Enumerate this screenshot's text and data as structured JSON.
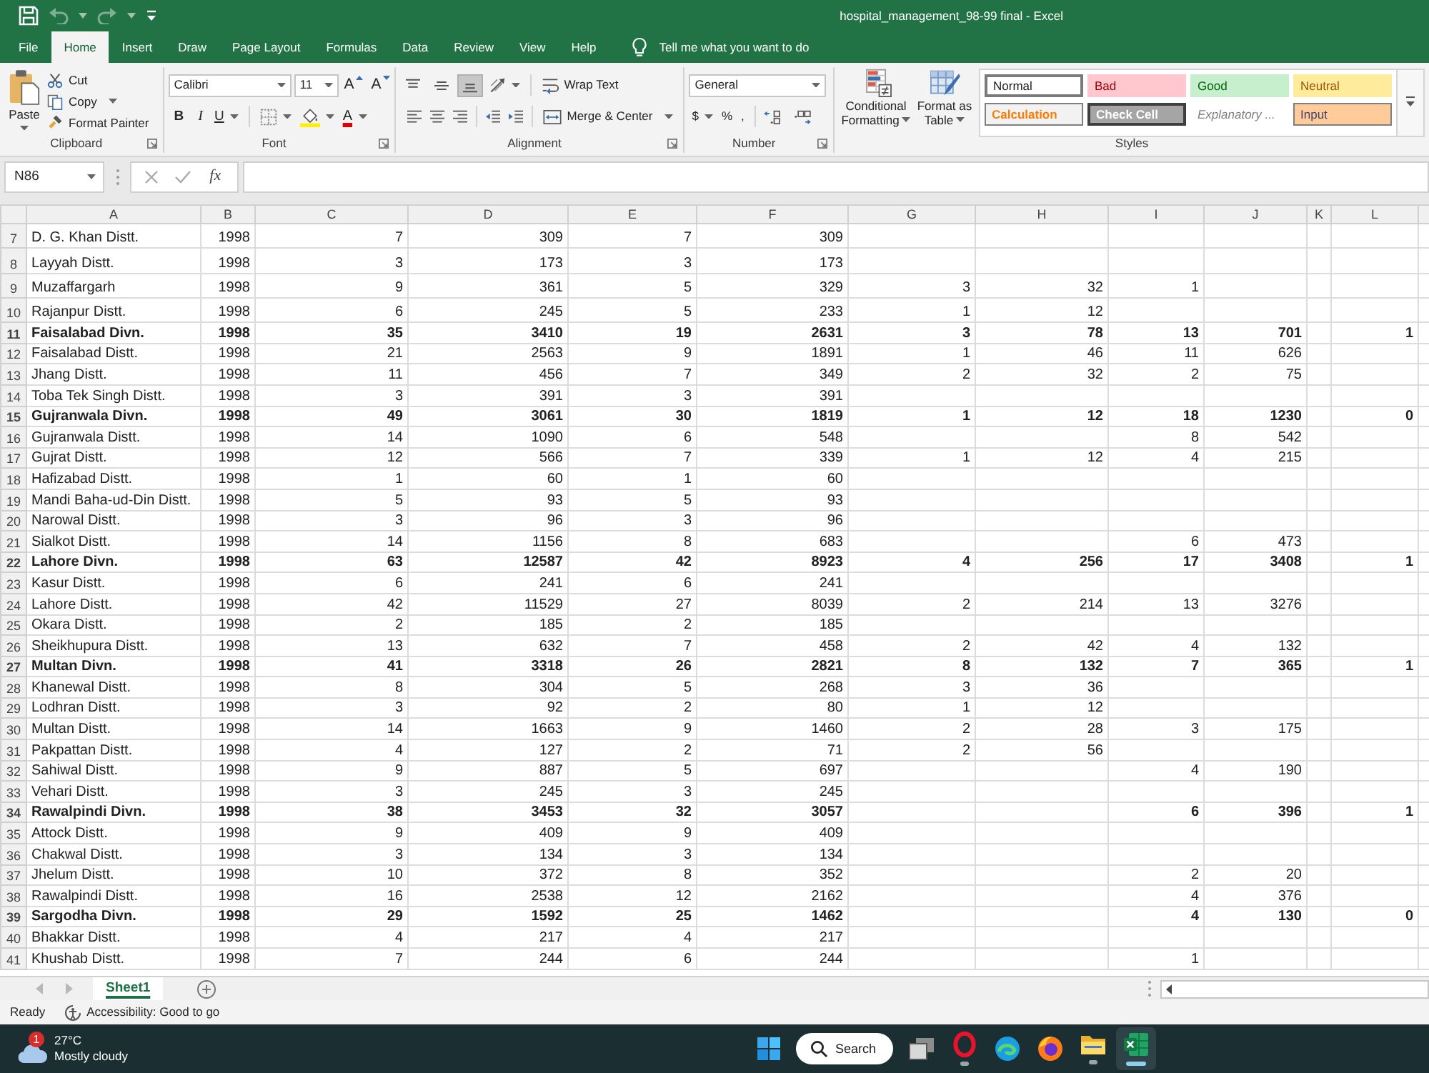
{
  "window": {
    "title": "hospital_management_98-99 final - Excel"
  },
  "menu_tabs": [
    {
      "label": "File",
      "selected": false
    },
    {
      "label": "Home",
      "selected": true
    },
    {
      "label": "Insert",
      "selected": false
    },
    {
      "label": "Draw",
      "selected": false
    },
    {
      "label": "Page Layout",
      "selected": false
    },
    {
      "label": "Formulas",
      "selected": false
    },
    {
      "label": "Data",
      "selected": false
    },
    {
      "label": "Review",
      "selected": false
    },
    {
      "label": "View",
      "selected": false
    },
    {
      "label": "Help",
      "selected": false
    }
  ],
  "tell_me": {
    "placeholder": "Tell me what you want to do"
  },
  "ribbon": {
    "clipboard": {
      "label": "Clipboard",
      "paste": "Paste",
      "cut": "Cut",
      "copy": "Copy",
      "format_painter": "Format Painter"
    },
    "font": {
      "label": "Font",
      "font_name": "Calibri",
      "font_size": "11",
      "grow": "A",
      "shrink": "A",
      "bold": "B",
      "italic": "I",
      "underline": "U",
      "font_color": "A"
    },
    "alignment": {
      "label": "Alignment",
      "vertical_align": [
        {
          "kind": "top",
          "selected": false
        },
        {
          "kind": "middle",
          "selected": false
        },
        {
          "kind": "bottom",
          "selected": true
        }
      ],
      "wrap_text": "Wrap Text",
      "merge_center": "Merge & Center"
    },
    "number": {
      "label": "Number",
      "format": "General",
      "currency": "$",
      "percent": "%",
      "comma": ","
    },
    "styles": {
      "label": "Styles",
      "conditional_formatting": "Conditional Formatting",
      "format_as_table": "Format as Table",
      "gallery": [
        {
          "label": "Normal",
          "kind": "normal",
          "selected": true
        },
        {
          "label": "Bad",
          "kind": "bad",
          "selected": false
        },
        {
          "label": "Good",
          "kind": "good",
          "selected": false
        },
        {
          "label": "Neutral",
          "kind": "neutral",
          "selected": false
        },
        {
          "label": "Calculation",
          "kind": "calculation",
          "selected": false
        },
        {
          "label": "Check Cell",
          "kind": "check",
          "selected": false
        },
        {
          "label": "Explanatory ...",
          "kind": "explanatory",
          "selected": false
        },
        {
          "label": "Input",
          "kind": "input",
          "selected": false
        }
      ]
    }
  },
  "formula_bar": {
    "name_box": "N86",
    "function_label": "fx"
  },
  "sheet": {
    "columns": [
      "A",
      "B",
      "C",
      "D",
      "E",
      "F",
      "G",
      "H",
      "I",
      "J",
      "K",
      "L"
    ],
    "rows": [
      {
        "number": "7",
        "kind": "district",
        "cells": [
          "D. G. Khan Distt.",
          "1998",
          "7",
          "309",
          "7",
          "309"
        ]
      },
      {
        "number": "8",
        "kind": "district",
        "cells": [
          "Layyah Distt.",
          "1998",
          "3",
          "173",
          "3",
          "173"
        ]
      },
      {
        "number": "9",
        "kind": "district",
        "cells": [
          "Muzaffargarh",
          "1998",
          "9",
          "361",
          "5",
          "329",
          "3",
          "32",
          "1"
        ]
      },
      {
        "number": "10",
        "kind": "district",
        "cells": [
          "Rajanpur Distt.",
          "1998",
          "6",
          "245",
          "5",
          "233",
          "1",
          "12"
        ]
      },
      {
        "number": "11",
        "kind": "division",
        "cells": [
          "Faisalabad Divn.",
          "1998",
          "35",
          "3410",
          "19",
          "2631",
          "3",
          "78",
          "13",
          "701",
          null,
          "1"
        ]
      },
      {
        "number": "12",
        "kind": "district",
        "cells": [
          "Faisalabad Distt.",
          "1998",
          "21",
          "2563",
          "9",
          "1891",
          "1",
          "46",
          "11",
          "626"
        ]
      },
      {
        "number": "13",
        "kind": "district",
        "cells": [
          "Jhang Distt.",
          "1998",
          "11",
          "456",
          "7",
          "349",
          "2",
          "32",
          "2",
          "75"
        ]
      },
      {
        "number": "14",
        "kind": "district",
        "cells": [
          "Toba Tek Singh Distt.",
          "1998",
          "3",
          "391",
          "3",
          "391"
        ]
      },
      {
        "number": "15",
        "kind": "division",
        "cells": [
          "Gujranwala Divn.",
          "1998",
          "49",
          "3061",
          "30",
          "1819",
          "1",
          "12",
          "18",
          "1230",
          null,
          "0"
        ]
      },
      {
        "number": "16",
        "kind": "district",
        "cells": [
          "Gujranwala Distt.",
          "1998",
          "14",
          "1090",
          "6",
          "548",
          null,
          null,
          "8",
          "542"
        ]
      },
      {
        "number": "17",
        "kind": "district",
        "cells": [
          "Gujrat Distt.",
          "1998",
          "12",
          "566",
          "7",
          "339",
          "1",
          "12",
          "4",
          "215"
        ]
      },
      {
        "number": "18",
        "kind": "district",
        "cells": [
          "Hafizabad Distt.",
          "1998",
          "1",
          "60",
          "1",
          "60"
        ]
      },
      {
        "number": "19",
        "kind": "district",
        "cells": [
          "Mandi Baha-ud-Din Distt.",
          "1998",
          "5",
          "93",
          "5",
          "93"
        ]
      },
      {
        "number": "20",
        "kind": "district",
        "cells": [
          "Narowal Distt.",
          "1998",
          "3",
          "96",
          "3",
          "96"
        ]
      },
      {
        "number": "21",
        "kind": "district",
        "cells": [
          "Sialkot Distt.",
          "1998",
          "14",
          "1156",
          "8",
          "683",
          null,
          null,
          "6",
          "473"
        ]
      },
      {
        "number": "22",
        "kind": "division",
        "cells": [
          "Lahore Divn.",
          "1998",
          "63",
          "12587",
          "42",
          "8923",
          "4",
          "256",
          "17",
          "3408",
          null,
          "1"
        ]
      },
      {
        "number": "23",
        "kind": "district",
        "cells": [
          "Kasur Distt.",
          "1998",
          "6",
          "241",
          "6",
          "241"
        ]
      },
      {
        "number": "24",
        "kind": "district",
        "cells": [
          "Lahore Distt.",
          "1998",
          "42",
          "11529",
          "27",
          "8039",
          "2",
          "214",
          "13",
          "3276"
        ]
      },
      {
        "number": "25",
        "kind": "district",
        "cells": [
          "Okara Distt.",
          "1998",
          "2",
          "185",
          "2",
          "185"
        ]
      },
      {
        "number": "26",
        "kind": "district",
        "cells": [
          "Sheikhupura Distt.",
          "1998",
          "13",
          "632",
          "7",
          "458",
          "2",
          "42",
          "4",
          "132"
        ]
      },
      {
        "number": "27",
        "kind": "division",
        "cells": [
          "Multan Divn.",
          "1998",
          "41",
          "3318",
          "26",
          "2821",
          "8",
          "132",
          "7",
          "365",
          null,
          "1"
        ]
      },
      {
        "number": "28",
        "kind": "district",
        "cells": [
          "Khanewal Distt.",
          "1998",
          "8",
          "304",
          "5",
          "268",
          "3",
          "36"
        ]
      },
      {
        "number": "29",
        "kind": "district",
        "cells": [
          "Lodhran Distt.",
          "1998",
          "3",
          "92",
          "2",
          "80",
          "1",
          "12"
        ]
      },
      {
        "number": "30",
        "kind": "district",
        "cells": [
          "Multan Distt.",
          "1998",
          "14",
          "1663",
          "9",
          "1460",
          "2",
          "28",
          "3",
          "175"
        ]
      },
      {
        "number": "31",
        "kind": "district",
        "cells": [
          "Pakpattan Distt.",
          "1998",
          "4",
          "127",
          "2",
          "71",
          "2",
          "56"
        ]
      },
      {
        "number": "32",
        "kind": "district",
        "cells": [
          "Sahiwal Distt.",
          "1998",
          "9",
          "887",
          "5",
          "697",
          null,
          null,
          "4",
          "190"
        ]
      },
      {
        "number": "33",
        "kind": "district",
        "cells": [
          "Vehari Distt.",
          "1998",
          "3",
          "245",
          "3",
          "245"
        ]
      },
      {
        "number": "34",
        "kind": "division",
        "cells": [
          "Rawalpindi Divn.",
          "1998",
          "38",
          "3453",
          "32",
          "3057",
          null,
          null,
          "6",
          "396",
          null,
          "1"
        ]
      },
      {
        "number": "35",
        "kind": "district",
        "cells": [
          "Attock Distt.",
          "1998",
          "9",
          "409",
          "9",
          "409"
        ]
      },
      {
        "number": "36",
        "kind": "district",
        "cells": [
          "Chakwal Distt.",
          "1998",
          "3",
          "134",
          "3",
          "134"
        ]
      },
      {
        "number": "37",
        "kind": "district",
        "cells": [
          "Jhelum Distt.",
          "1998",
          "10",
          "372",
          "8",
          "352",
          null,
          null,
          "2",
          "20"
        ]
      },
      {
        "number": "38",
        "kind": "district",
        "cells": [
          "Rawalpindi Distt.",
          "1998",
          "16",
          "2538",
          "12",
          "2162",
          null,
          null,
          "4",
          "376"
        ]
      },
      {
        "number": "39",
        "kind": "division",
        "cells": [
          "Sargodha Divn.",
          "1998",
          "29",
          "1592",
          "25",
          "1462",
          null,
          null,
          "4",
          "130",
          null,
          "0"
        ]
      },
      {
        "number": "40",
        "kind": "district",
        "cells": [
          "Bhakkar Distt.",
          "1998",
          "4",
          "217",
          "4",
          "217"
        ]
      },
      {
        "number": "41",
        "kind": "district",
        "cells": [
          "Khushab Distt.",
          "1998",
          "7",
          "244",
          "6",
          "244",
          null,
          null,
          "1"
        ]
      }
    ]
  },
  "sheet_tabs": [
    {
      "label": "Sheet1",
      "selected": true
    }
  ],
  "status_bar": {
    "mode": "Ready",
    "accessibility": "Accessibility: Good to go"
  },
  "taskbar": {
    "weather": {
      "badge": "1",
      "temperature": "27°C",
      "condition": "Mostly cloudy"
    },
    "search": {
      "label": "Search"
    },
    "apps": [
      {
        "kind": "task_view",
        "running": false,
        "selected": false
      },
      {
        "kind": "browser_red",
        "running": true,
        "selected": false
      },
      {
        "kind": "browser_blue",
        "running": false,
        "selected": false
      },
      {
        "kind": "browser_orange",
        "running": false,
        "selected": false
      },
      {
        "kind": "folder",
        "running": true,
        "selected": false
      },
      {
        "kind": "spreadsheet",
        "running": true,
        "selected": true
      }
    ]
  }
}
